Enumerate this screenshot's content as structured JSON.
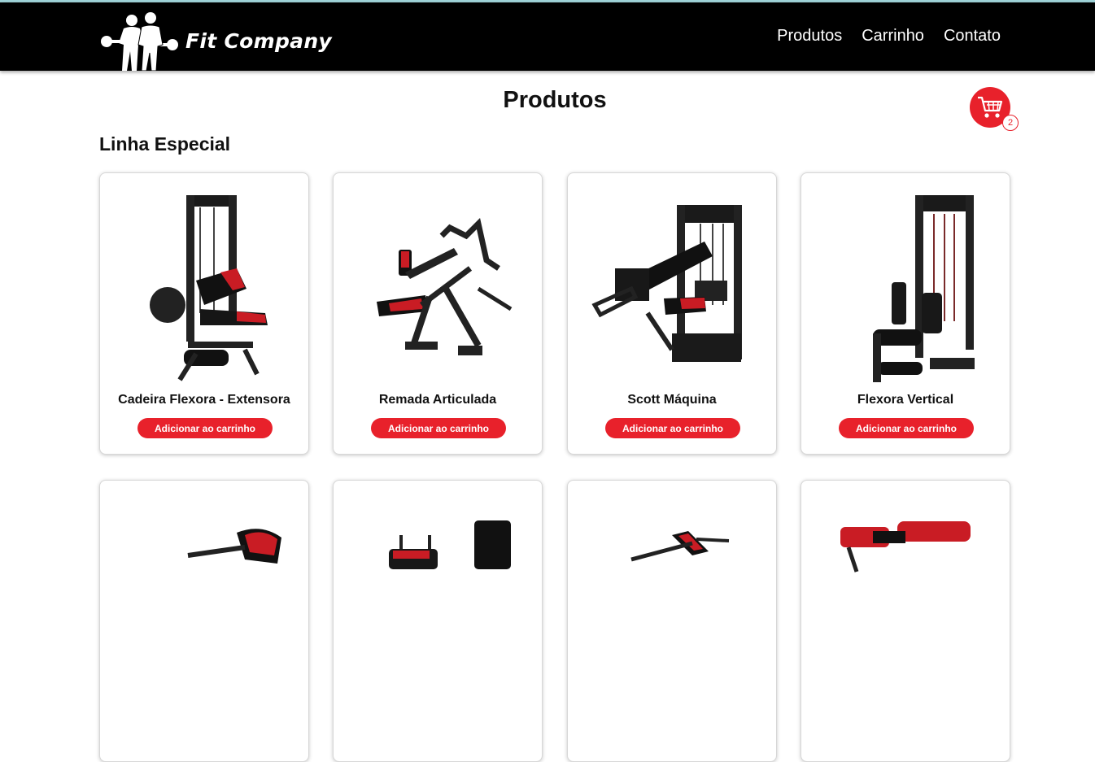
{
  "header": {
    "brand": "Fit Company",
    "nav": [
      "Produtos",
      "Carrinho",
      "Contato"
    ]
  },
  "page": {
    "title": "Produtos",
    "cart_count": "2",
    "section_title": "Linha Especial"
  },
  "products": [
    {
      "name": "Cadeira Flexora - Extensora",
      "button": "Adicionar ao carrinho"
    },
    {
      "name": "Remada Articulada",
      "button": "Adicionar ao carrinho"
    },
    {
      "name": "Scott Máquina",
      "button": "Adicionar ao carrinho"
    },
    {
      "name": "Flexora Vertical",
      "button": "Adicionar ao carrinho"
    },
    {
      "name": "",
      "button": ""
    },
    {
      "name": "",
      "button": ""
    },
    {
      "name": "",
      "button": ""
    },
    {
      "name": "",
      "button": ""
    }
  ],
  "colors": {
    "accent": "#e8212b",
    "header_bg": "#000000"
  }
}
